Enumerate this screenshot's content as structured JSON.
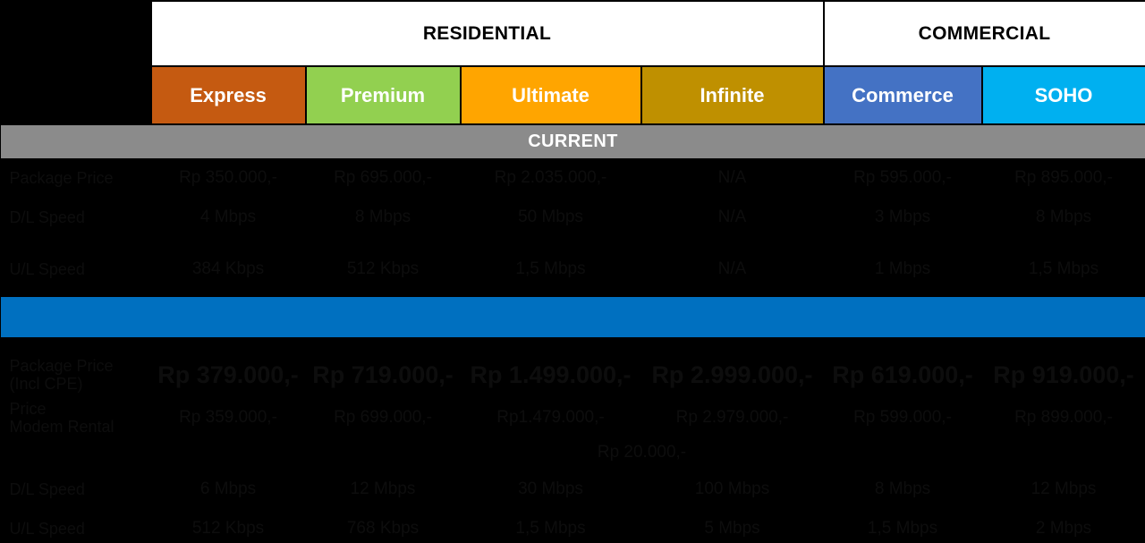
{
  "categories": [
    {
      "label": "RESIDENTIAL",
      "span": 4
    },
    {
      "label": "COMMERCIAL",
      "span": 2
    }
  ],
  "packages": [
    {
      "name": "Express",
      "color": "#c55a11"
    },
    {
      "name": "Premium",
      "color": "#92d050"
    },
    {
      "name": "Ultimate",
      "color": "#ffa500"
    },
    {
      "name": "Infinite",
      "color": "#bf9000"
    },
    {
      "name": "Commerce",
      "color": "#4472c4"
    },
    {
      "name": "SOHO",
      "color": "#00b0f0"
    }
  ],
  "sections": [
    {
      "title": "CURRENT",
      "bar_color": "#8b8b8b",
      "rows": [
        {
          "label": "Package Price",
          "values": [
            "Rp 350.000,-",
            "Rp 695.000,-",
            "Rp 2.035.000,-",
            "N/A",
            "Rp 595.000,-",
            "Rp 895.000,-"
          ]
        },
        {
          "label": "D/L Speed",
          "values": [
            "4 Mbps",
            "8 Mbps",
            "50 Mbps",
            "N/A",
            "3 Mbps",
            "8 Mbps"
          ]
        },
        {
          "label": "U/L Speed",
          "values": [
            "384 Kbps",
            "512 Kbps",
            "1,5 Mbps",
            "N/A",
            "1 Mbps",
            "1,5 Mbps"
          ]
        }
      ]
    },
    {
      "title": "",
      "bar_color": "#0070c0",
      "rows": [
        {
          "label": "Package Price\n(Incl CPE)",
          "label_line1": "Package Price",
          "label_line2": "(Incl CPE)",
          "emphasis": true,
          "values": [
            "Rp 379.000,-",
            "Rp 719.000,-",
            "Rp 1.499.000,-",
            "Rp 2.999.000,-",
            "Rp 619.000,-",
            "Rp 919.000,-"
          ]
        },
        {
          "label_line1": "Price",
          "label_line2": "Modem Rental",
          "values": [
            "Rp 359.000,-",
            "Rp 699.000,-",
            "Rp1.479.000,-",
            "Rp 2.979.000,-",
            "Rp 599.000,-",
            "Rp 899.000,-"
          ],
          "note": "Rp 20.000,-"
        },
        {
          "label": "D/L Speed",
          "values": [
            "6 Mbps",
            "12 Mbps",
            "30 Mbps",
            "100 Mbps",
            "8 Mbps",
            "12 Mbps"
          ]
        },
        {
          "label": "U/L Speed",
          "values": [
            "512 Kbps",
            "768 Kbps",
            "1,5 Mbps",
            "5 Mbps",
            "1,5 Mbps",
            "2 Mbps"
          ]
        }
      ]
    }
  ],
  "theme": {
    "background": "#000000",
    "text_on_dark": "#0d0d0d",
    "band_background": "#ffffff",
    "band_text": "#000000"
  }
}
